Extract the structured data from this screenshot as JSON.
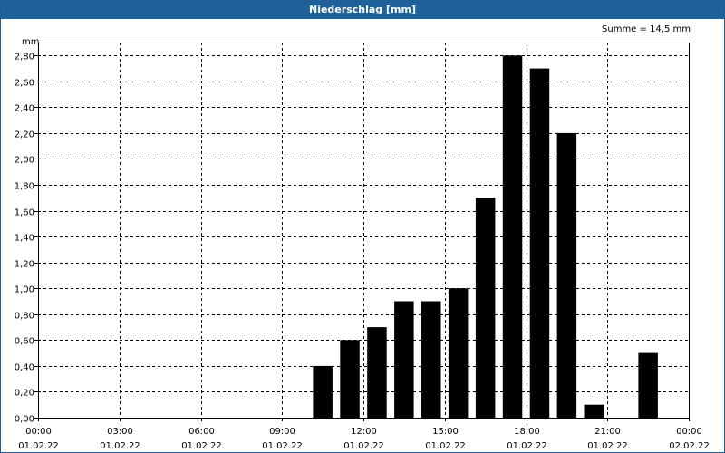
{
  "header": {
    "title": "Niederschlag [mm]",
    "sum_label": "Summe = 14,5 mm"
  },
  "chart_data": {
    "type": "bar",
    "title": "Niederschlag [mm]",
    "annotation": "Summe = 14,5 mm",
    "ylabel": "mm",
    "ylim": [
      0,
      2.9
    ],
    "yticks": [
      {
        "v": 0.0,
        "label": "0,00"
      },
      {
        "v": 0.2,
        "label": "0,20"
      },
      {
        "v": 0.4,
        "label": "0,40"
      },
      {
        "v": 0.6,
        "label": "0,60"
      },
      {
        "v": 0.8,
        "label": "0,80"
      },
      {
        "v": 1.0,
        "label": "1,00"
      },
      {
        "v": 1.2,
        "label": "1,20"
      },
      {
        "v": 1.4,
        "label": "1,40"
      },
      {
        "v": 1.6,
        "label": "1,60"
      },
      {
        "v": 1.8,
        "label": "1,80"
      },
      {
        "v": 2.0,
        "label": "2,00"
      },
      {
        "v": 2.2,
        "label": "2,20"
      },
      {
        "v": 2.4,
        "label": "2,40"
      },
      {
        "v": 2.6,
        "label": "2,60"
      },
      {
        "v": 2.8,
        "label": "2,80"
      }
    ],
    "xlim": [
      0,
      24
    ],
    "xticks": [
      {
        "h": 0,
        "time": "00:00",
        "date": "01.02.22"
      },
      {
        "h": 3,
        "time": "03:00",
        "date": "01.02.22"
      },
      {
        "h": 6,
        "time": "06:00",
        "date": "01.02.22"
      },
      {
        "h": 9,
        "time": "09:00",
        "date": "01.02.22"
      },
      {
        "h": 12,
        "time": "12:00",
        "date": "01.02.22"
      },
      {
        "h": 15,
        "time": "15:00",
        "date": "01.02.22"
      },
      {
        "h": 18,
        "time": "18:00",
        "date": "01.02.22"
      },
      {
        "h": 21,
        "time": "21:00",
        "date": "01.02.22"
      },
      {
        "h": 24,
        "time": "00:00",
        "date": "02.02.22"
      }
    ],
    "grid": true,
    "bar_color": "#000000",
    "x": [
      10.5,
      11.5,
      12.5,
      13.5,
      14.5,
      15.5,
      16.5,
      17.5,
      18.5,
      19.5,
      20.5,
      21.5,
      22.5
    ],
    "values": [
      0.4,
      0.6,
      0.7,
      0.9,
      0.9,
      1.0,
      1.7,
      2.8,
      2.7,
      2.2,
      0.1,
      0.0,
      0.5
    ]
  }
}
